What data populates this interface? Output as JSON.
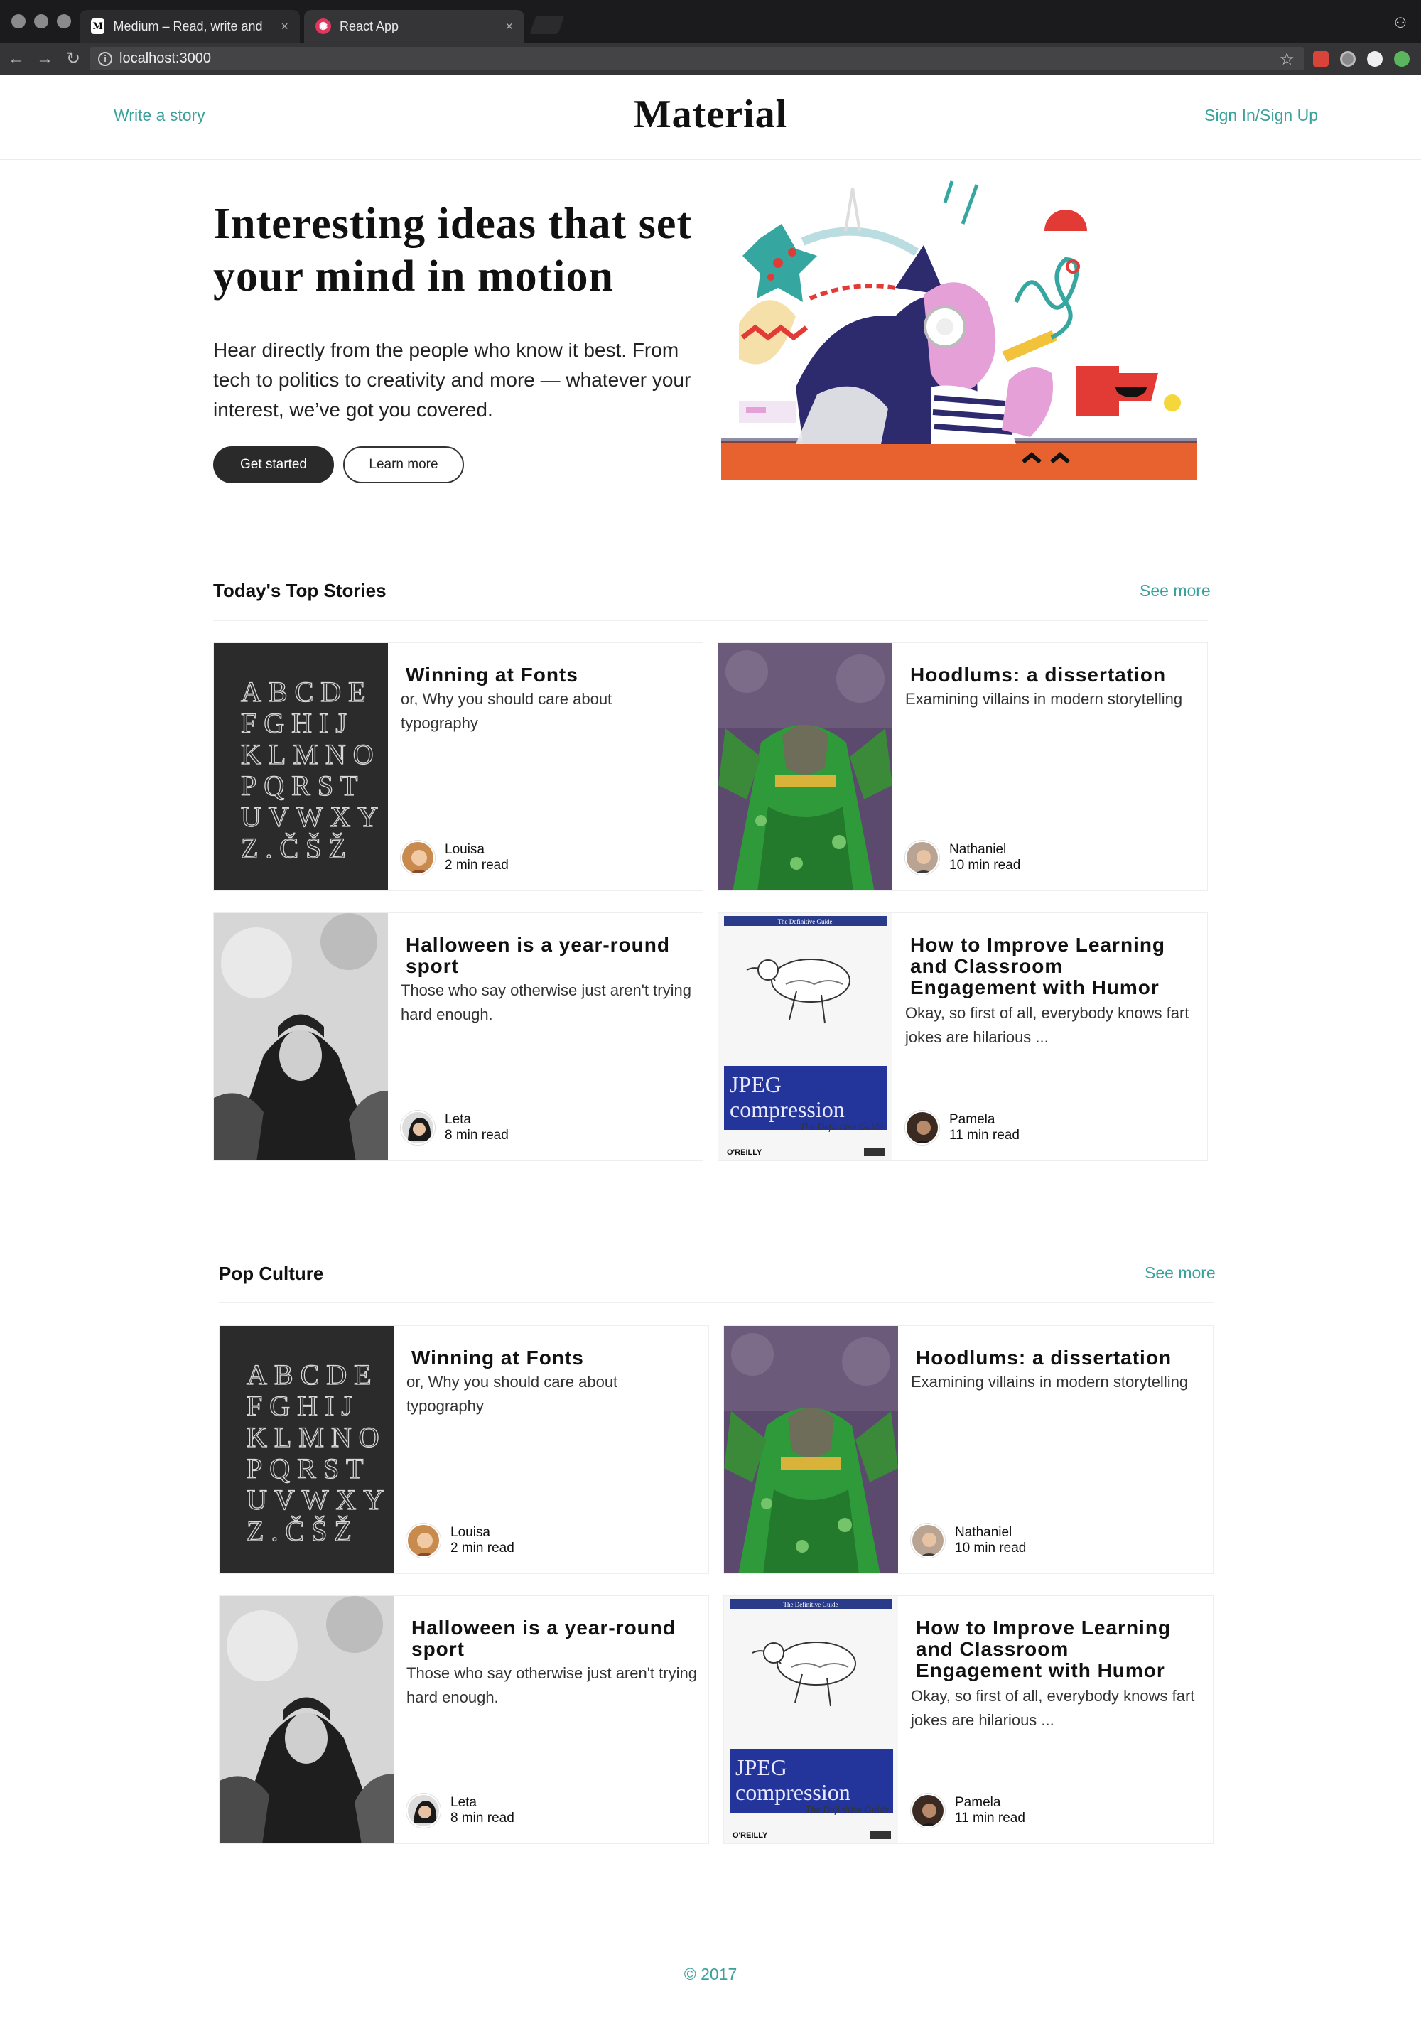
{
  "browser": {
    "tabs": [
      {
        "label": "Medium – Read, write and sha",
        "favicon": "M"
      },
      {
        "label": "React App",
        "favicon": "react-logo"
      }
    ],
    "url": "localhost:3000"
  },
  "header": {
    "write_link": "Write a story",
    "brand": "Material",
    "signin_link": "Sign In/Sign Up"
  },
  "hero": {
    "title": "Interesting ideas that set your mind in motion",
    "subtitle": "Hear directly from the people who know it best. From tech to politics to creativity and more — whatever your interest, we’ve got you covered.",
    "primary_button": "Get started",
    "secondary_button": "Learn more"
  },
  "sections": [
    {
      "title": "Today's Top Stories",
      "more": "See more",
      "cards": [
        {
          "title": "Winning at Fonts",
          "desc": "or, Why you should care about typography",
          "author": "Louisa",
          "read": "2 min read",
          "image": "alphabet"
        },
        {
          "title": "Hoodlums: a dissertation",
          "desc": "Examining villains in modern storytelling",
          "author": "Nathaniel",
          "read": "10 min read",
          "image": "villain"
        },
        {
          "title": "Halloween is a year-round sport",
          "desc": "Those who say otherwise just aren't trying hard enough.",
          "author": "Leta",
          "read": "8 min read",
          "image": "portrait"
        },
        {
          "title": "How to Improve Learning and Classroom Engagement with Humor",
          "desc": "Okay, so first of all, everybody knows fart jokes are hilarious ...",
          "author": "Pamela",
          "read": "11 min read",
          "image": "book"
        }
      ]
    },
    {
      "title": "Pop Culture",
      "more": "See more",
      "cards": [
        {
          "title": "Winning at Fonts",
          "desc": "or, Why you should care about typography",
          "author": "Louisa",
          "read": "2 min read",
          "image": "alphabet"
        },
        {
          "title": "Hoodlums: a dissertation",
          "desc": "Examining villains in modern storytelling",
          "author": "Nathaniel",
          "read": "10 min read",
          "image": "villain"
        },
        {
          "title": "Halloween is a year-round sport",
          "desc": "Those who say otherwise just aren't trying hard enough.",
          "author": "Leta",
          "read": "8 min read",
          "image": "portrait"
        },
        {
          "title": "How to Improve Learning and Classroom Engagement with Humor",
          "desc": "Okay, so first of all, everybody knows fart jokes are hilarious ...",
          "author": "Pamela",
          "read": "11 min read",
          "image": "book"
        }
      ]
    }
  ],
  "book_cover": {
    "top_line": "The Definitive Guide",
    "title_1": "JPEG",
    "title_2": "compression",
    "subtitle": "The Definitive Guide",
    "publisher": "O'REILLY"
  },
  "alphabet_rows": [
    "ABCDE",
    "FGHIJ",
    "KLMNO",
    "PQRST",
    "UVWXY",
    "Z.ČŠŽ"
  ],
  "footer": "© 2017",
  "colors": {
    "accent": "#3aa29a",
    "button_dark": "#2a2a2a"
  }
}
